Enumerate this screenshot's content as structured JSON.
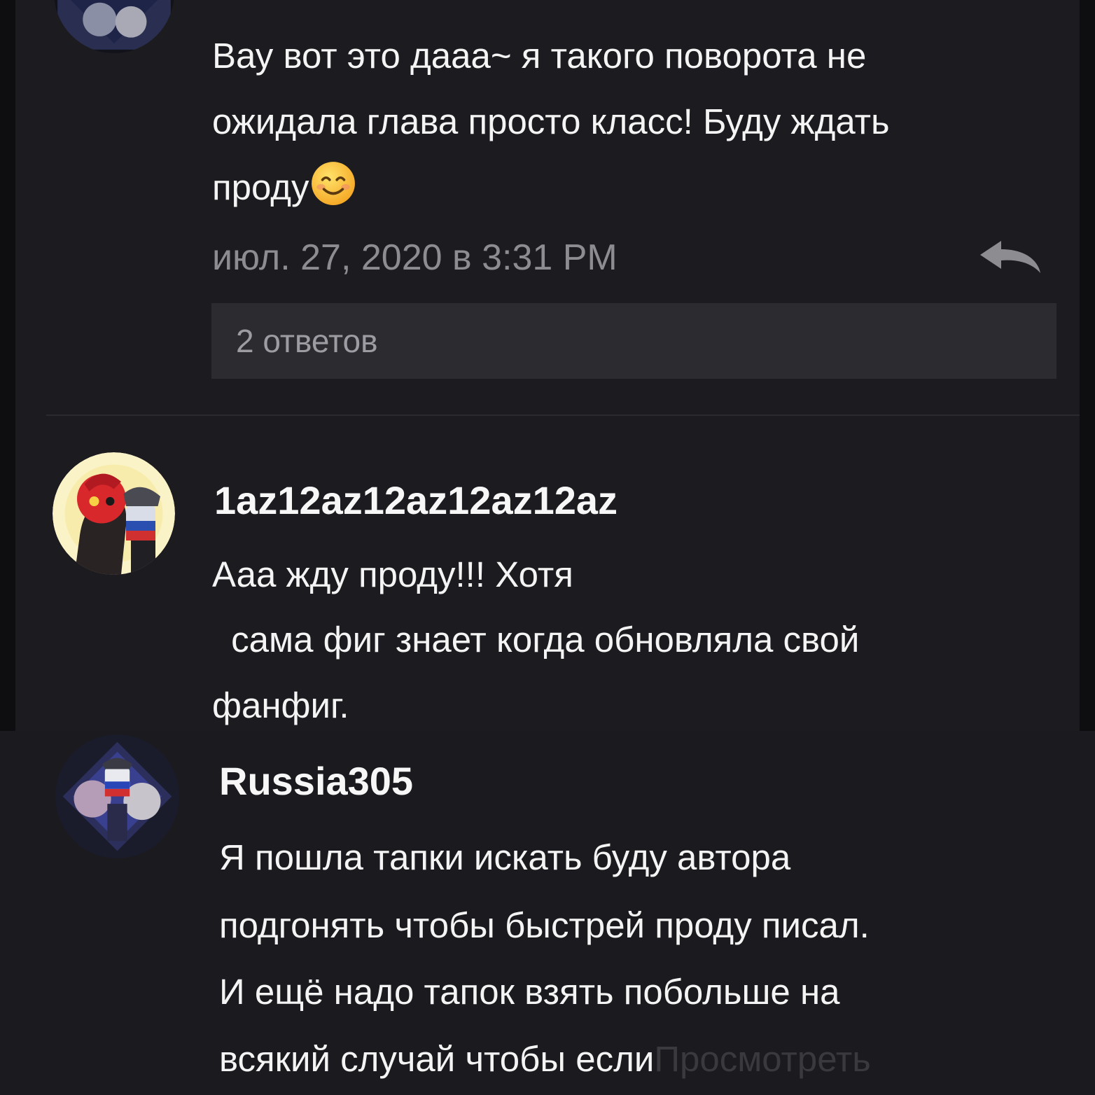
{
  "comments": [
    {
      "text_lines": [
        "Вау вот это дааа~ я такого поворота не",
        "ожидала глава просто класс! Буду ждать",
        "проду"
      ],
      "emoji": "smiling-face-emoji",
      "timestamp": "июл. 27, 2020 в 3:31 PM",
      "replies_label": "2 ответов"
    },
    {
      "username": "1az12az12az12az12az",
      "text_lines": [
        "Ааа жду проду!!! Хотя",
        " сама фиг знает когда обновляла свой",
        "фанфиг."
      ]
    },
    {
      "username": "Russia305",
      "text_lines": [
        "Я пошла тапки искать буду автора",
        "подгонять чтобы быстрей проду писал.",
        "И ещё надо тапок взять побольше на",
        "всякий случай чтобы если"
      ],
      "more_label": "Просмотреть"
    }
  ],
  "icons": {
    "reply": "reply-arrow-icon"
  },
  "colors": {
    "background": "#0e0e10",
    "panel": "#1c1b1f",
    "text": "#f4f4f4",
    "muted": "#8d8c91",
    "replies_bar": "#2c2b30"
  }
}
